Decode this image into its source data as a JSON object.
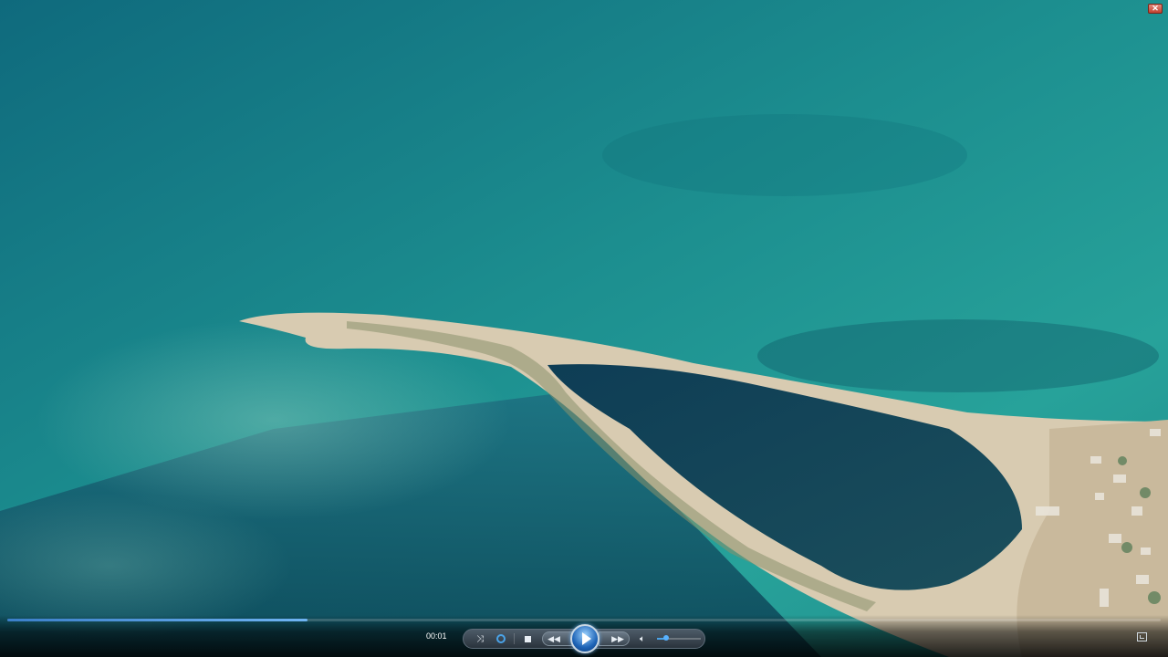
{
  "player": {
    "time_elapsed": "00:01",
    "progress_fraction": 0.26,
    "volume_fraction": 0.2,
    "accent_color": "#4aa3e8"
  },
  "icons": {
    "close": "close-icon",
    "shuffle": "shuffle-icon",
    "repeat": "repeat-icon",
    "stop": "stop-icon",
    "previous": "rewind-icon",
    "play": "play-icon",
    "next": "fast-forward-icon",
    "mute": "speaker-icon",
    "fullscreen": "fullscreen-icon"
  }
}
